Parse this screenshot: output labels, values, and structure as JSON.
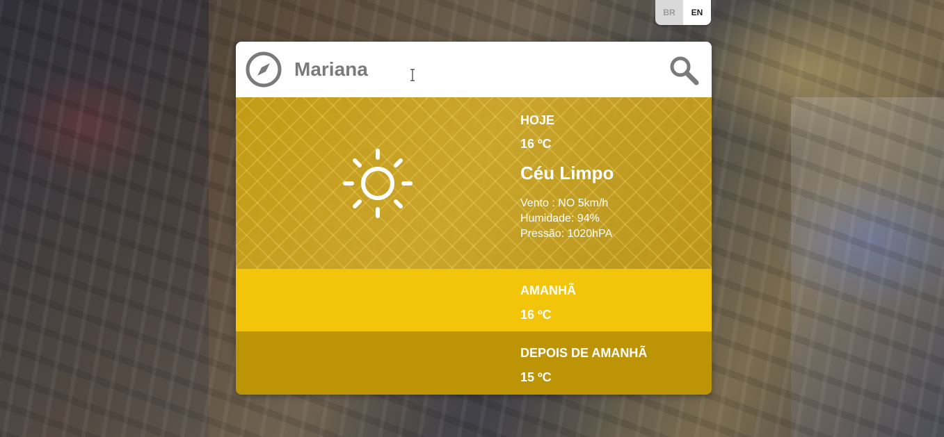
{
  "language": {
    "options": [
      "BR",
      "EN"
    ],
    "active": "EN"
  },
  "search": {
    "value": "Mariana",
    "left_icon": "compass-icon",
    "right_icon": "search-icon"
  },
  "today": {
    "label": "HOJE",
    "temperature": "16 ºC",
    "description": "Céu Limpo",
    "icon": "sun-icon",
    "wind": "Vento : NO 5km/h",
    "humidity": "Humidade: 94%",
    "pressure": "Pressão: 1020hPA"
  },
  "tomorrow": {
    "label": "AMANHÃ",
    "temperature": "16 ºC"
  },
  "after_tomorrow": {
    "label": "DEPOIS DE AMANHÃ",
    "temperature": "15 ºC"
  },
  "colors": {
    "today_bg": "#d4aa1a",
    "tomorrow_bg": "#f2c40a",
    "after_tomorrow_bg": "#bd9405",
    "text": "#ffffff",
    "input_text": "#7a7a7a"
  }
}
